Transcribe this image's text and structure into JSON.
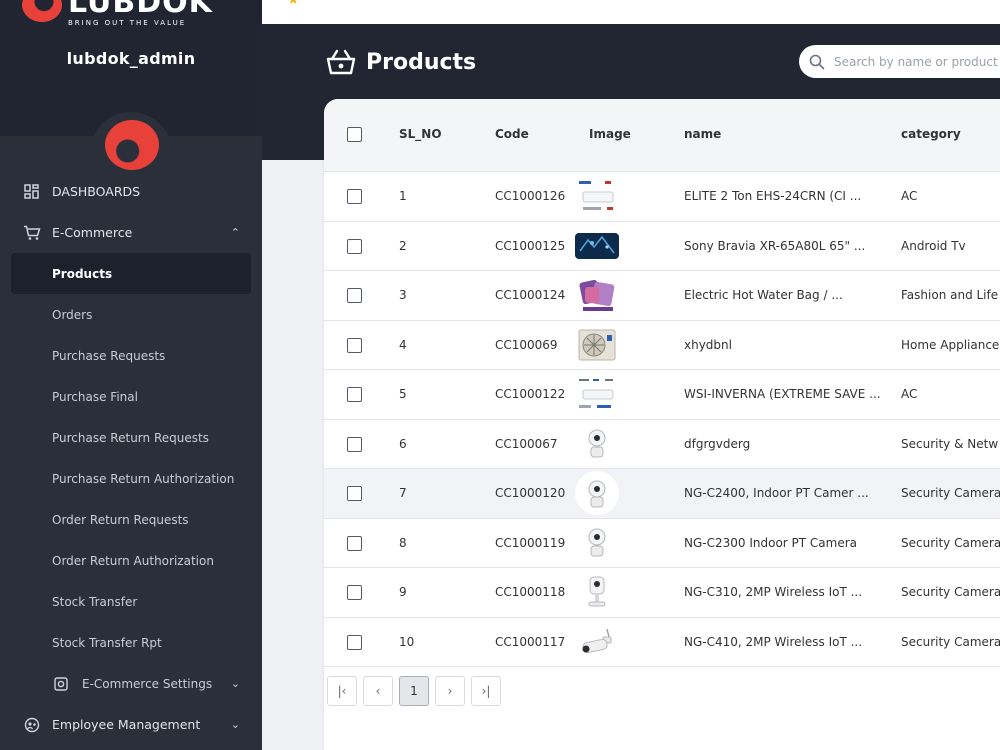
{
  "brand": {
    "name": "LUBDOK",
    "tagline": "BRING OUT THE VALUE"
  },
  "user": {
    "name": "lubdok_admin"
  },
  "sidebar": {
    "items": [
      {
        "label": "DASHBOARDS",
        "icon": "dashboard-icon"
      },
      {
        "label": "E-Commerce",
        "icon": "cart-icon",
        "chevron": "⌃"
      },
      {
        "label": "Products"
      },
      {
        "label": "Orders"
      },
      {
        "label": "Purchase Requests"
      },
      {
        "label": "Purchase Final"
      },
      {
        "label": "Purchase Return Requests"
      },
      {
        "label": "Purchase Return Authorization"
      },
      {
        "label": "Order Return Requests"
      },
      {
        "label": "Order Return Authorization"
      },
      {
        "label": "Stock Transfer"
      },
      {
        "label": "Stock Transfer Rpt"
      },
      {
        "label": "E-Commerce Settings",
        "icon": "settings-box-icon",
        "chevron": "⌄"
      },
      {
        "label": "Employee Management",
        "icon": "employee-icon",
        "chevron": "⌄"
      }
    ]
  },
  "page": {
    "title": "Products"
  },
  "search": {
    "placeholder": "Search by name or product"
  },
  "table": {
    "headers": {
      "sl": "SL_NO",
      "code": "Code",
      "image": "Image",
      "name": "name",
      "category": "category"
    },
    "rows": [
      {
        "sl": "1",
        "code": "CC1000126",
        "name": "ELITE 2 Ton EHS-24CRN (CI ...",
        "category": "AC",
        "image": "ac-unit-image"
      },
      {
        "sl": "2",
        "code": "CC1000125",
        "name": "Sony Bravia XR-65A80L 65\" ...",
        "category": "Android Tv",
        "image": "tv-image"
      },
      {
        "sl": "3",
        "code": "CC1000124",
        "name": "Electric Hot Water Bag / ...",
        "category": "Fashion and Life",
        "image": "hot-water-bag-image"
      },
      {
        "sl": "4",
        "code": "CC100069",
        "name": "xhydbnl",
        "category": "Home Appliance",
        "image": "outdoor-unit-image"
      },
      {
        "sl": "5",
        "code": "CC1000122",
        "name": "WSI-INVERNA (EXTREME SAVE ...",
        "category": "AC",
        "image": "ac-unit-image"
      },
      {
        "sl": "6",
        "code": "CC100067",
        "name": "dfgrgvderg",
        "category": "Security & Netw",
        "image": "camera-image"
      },
      {
        "sl": "7",
        "code": "CC1000120",
        "name": "NG-C2400, Indoor PT Camer ...",
        "category": "Security Camera",
        "image": "camera-image"
      },
      {
        "sl": "8",
        "code": "CC1000119",
        "name": "NG-C2300 Indoor PT Camera",
        "category": "Security Camera",
        "image": "camera-image"
      },
      {
        "sl": "9",
        "code": "CC1000118",
        "name": "NG-C310, 2MP Wireless IoT ...",
        "category": "Security Camera",
        "image": "camera-image"
      },
      {
        "sl": "10",
        "code": "CC1000117",
        "name": "NG-C410, 2MP Wireless IoT ...",
        "category": "Security Camera",
        "image": "bullet-camera-image"
      }
    ]
  },
  "pagination": {
    "first": "|‹",
    "prev": "‹",
    "current": "1",
    "next": "›",
    "last": "›|"
  },
  "colors": {
    "accent": "#e8413a",
    "sidebar": "#2a2f3a",
    "header": "#212632",
    "star": "#f5b40d"
  }
}
